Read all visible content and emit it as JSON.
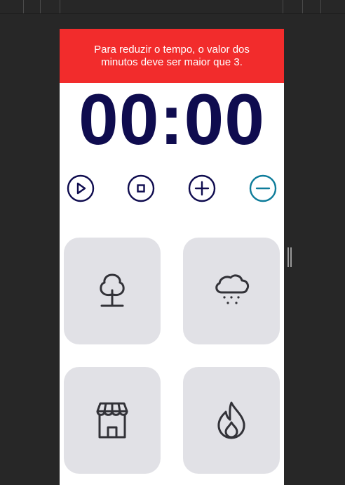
{
  "alert": {
    "message": "Para reduzir o tempo, o valor dos minutos deve ser maior que 3."
  },
  "timer": {
    "display": "00:00"
  },
  "controls": [
    {
      "icon": "play-icon"
    },
    {
      "icon": "stop-icon"
    },
    {
      "icon": "plus-icon"
    },
    {
      "icon": "minus-icon"
    }
  ],
  "sound_cards": [
    {
      "icon": "tree-icon"
    },
    {
      "icon": "rain-cloud-icon"
    },
    {
      "icon": "storefront-icon"
    },
    {
      "icon": "fire-icon"
    }
  ],
  "colors": {
    "alert_bg": "#f22c2c",
    "timer_text": "#0f0c4f",
    "accent_active": "#0e7c9a",
    "card_bg": "#e1e1e6",
    "icon_stroke": "#323238"
  }
}
